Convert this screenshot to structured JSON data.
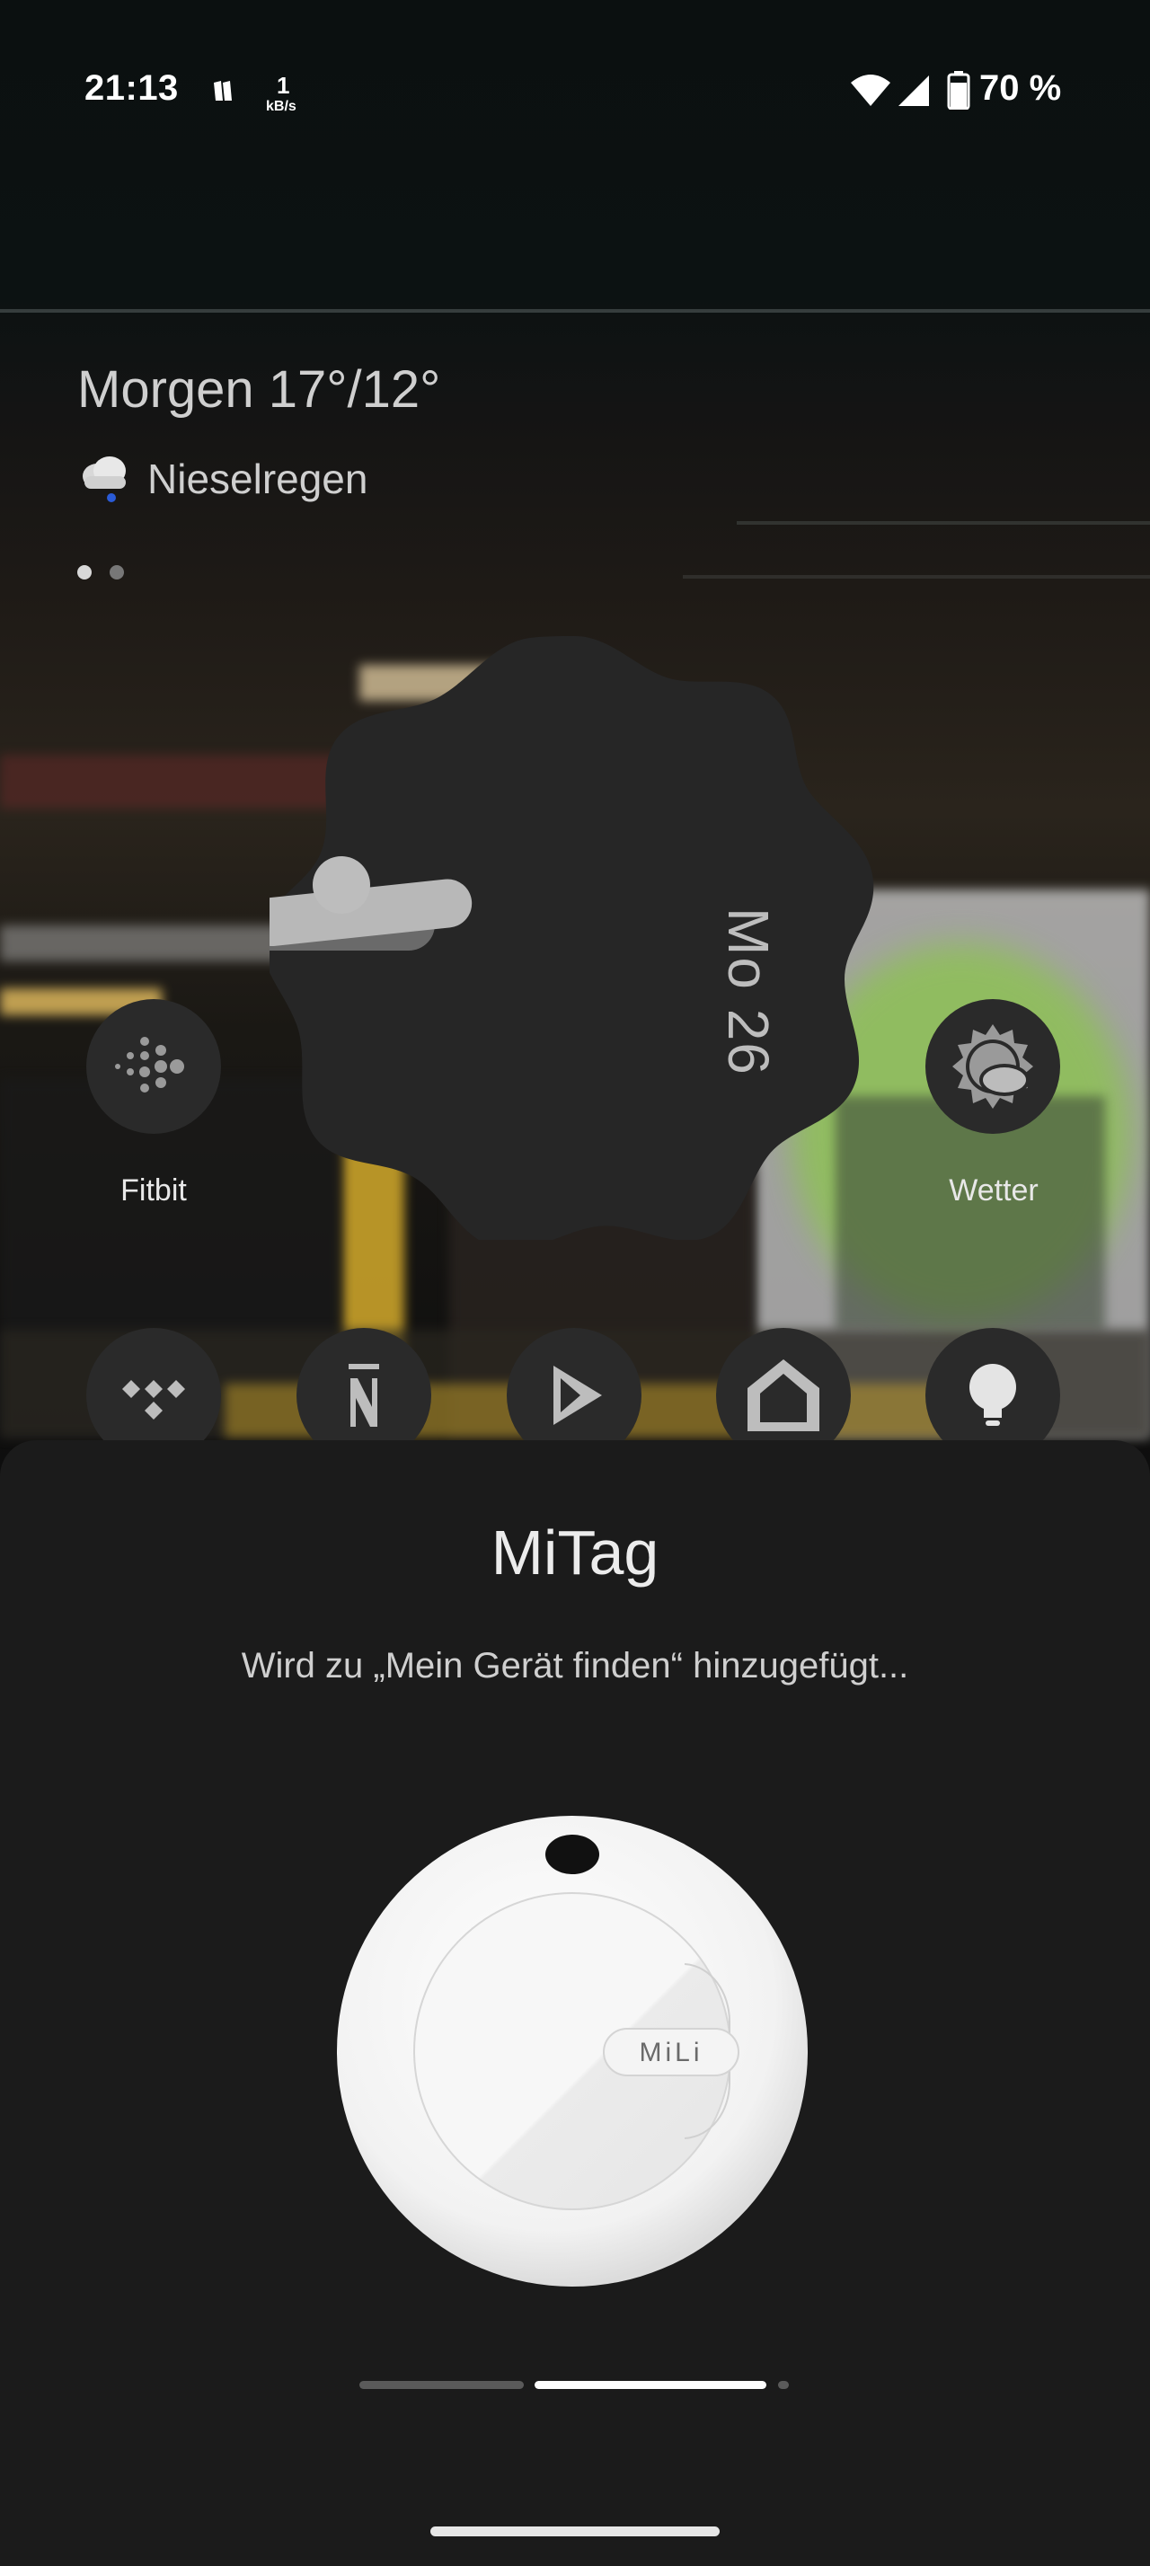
{
  "status_bar": {
    "time": "21:13",
    "network_speed_value": "1",
    "network_speed_unit": "kB/s",
    "battery_percent": "70 %",
    "icons": [
      "notification-app-icon",
      "wifi-icon",
      "cellular-signal-icon",
      "battery-icon"
    ]
  },
  "weather": {
    "title": "Morgen 17°/12°",
    "condition": "Nieselregen",
    "icon": "drizzle-cloud-icon"
  },
  "clock_widget": {
    "date": "Mo 26"
  },
  "apps": [
    {
      "label": "Fitbit",
      "icon": "fitbit-icon"
    },
    {
      "label": "Wetter",
      "icon": "weather-sun-cloud-icon"
    },
    {
      "label": "",
      "icon": "tidal-icon"
    },
    {
      "label": "",
      "icon": "news-icon"
    },
    {
      "label": "",
      "icon": "play-store-icon"
    },
    {
      "label": "",
      "icon": "home-icon"
    },
    {
      "label": "",
      "icon": "lightbulb-icon"
    }
  ],
  "sheet": {
    "title": "MiTag",
    "subtitle": "Wird zu „Mein Gerät finden“ hinzugefügt...",
    "device_brand": "MiLi"
  },
  "progress": {
    "step_current": 2,
    "step_total": 3
  },
  "colors": {
    "sheet_background": "#1b1b1b",
    "progress_active": "#ffffff",
    "progress_inactive": "#5a5a5a"
  }
}
